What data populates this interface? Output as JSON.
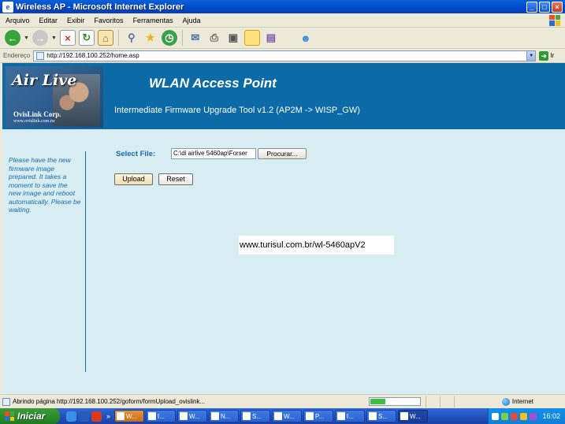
{
  "window": {
    "title": "Wireless AP - Microsoft Internet Explorer"
  },
  "menu": [
    "Arquivo",
    "Editar",
    "Exibir",
    "Favoritos",
    "Ferramentas",
    "Ajuda"
  ],
  "address": {
    "label": "Endereço",
    "url": "http://192.168.100.252/home.asp",
    "go_label": "Ir"
  },
  "header": {
    "logo_text": "Air Live",
    "logo_corp": "OvisLink Corp.",
    "logo_url": "www.ovislink.com.tw",
    "title": "WLAN Access Point",
    "subtitle": "Intermediate Firmware Upgrade Tool v1.2 (AP2M -> WISP_GW)"
  },
  "sidebar": {
    "text": "Please have the new firmware image prepared. It takes a moment to save the new image and reboot automatically. Please be waiting."
  },
  "form": {
    "select_label": "Select File:",
    "file_value": "C:\\di airlive 5460ap\\Forser",
    "browse_label": "Procurar...",
    "upload_label": "Upload",
    "reset_label": "Reset"
  },
  "watermark": "www.turisul.com.br/wl-5460apV2",
  "status": {
    "text": "Abrindo página http://192.168.100.252/goform/formUpload_ovislink...",
    "zone": "Internet",
    "progress": 0.3
  },
  "taskbar": {
    "start_label": "Iniciar",
    "tasks": [
      "W...",
      "I...",
      "W...",
      "N...",
      "S...",
      "W...",
      "P...",
      "I...",
      "S...",
      "W..."
    ],
    "clock": "16:02"
  }
}
